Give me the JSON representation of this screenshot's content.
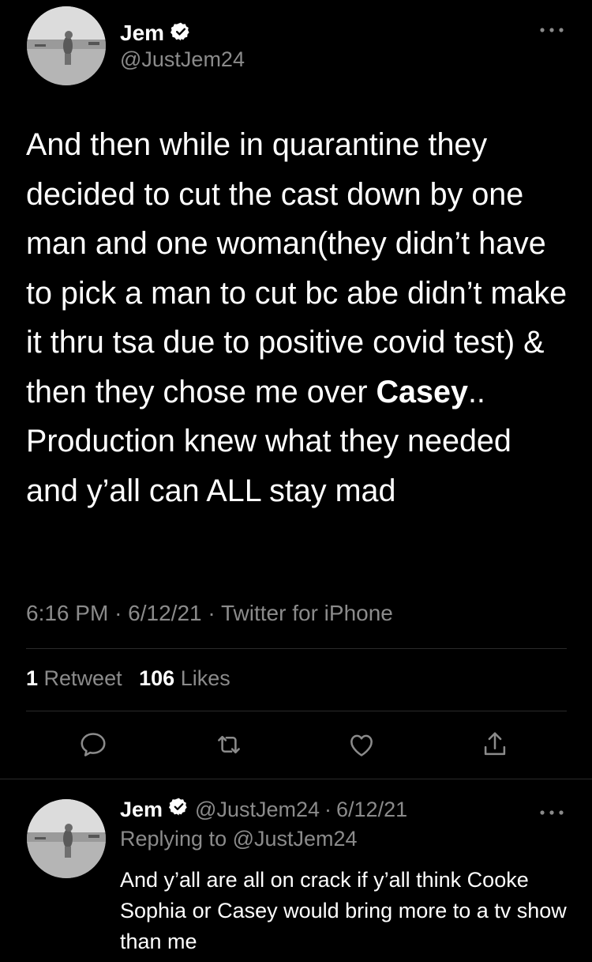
{
  "tweet": {
    "author_name": "Jem",
    "handle": "@JustJem24",
    "more_icon": "more-horizontal-icon",
    "verified_icon": "verified-badge-icon",
    "text_before_bold": "And then while in quarantine they decided to cut the cast down by one man and one woman(they didn’t have to pick a man to cut bc abe didn’t make it thru tsa due to positive covid test) & then they chose me over ",
    "text_bold": "Casey",
    "text_after_bold": ".. Production knew what they needed and y’all can ALL stay mad",
    "time": "6:16 PM",
    "date": "6/12/21",
    "source": "Twitter for iPhone",
    "separator": "·",
    "stats": {
      "retweets_count": "1",
      "retweets_label": "Retweet",
      "likes_count": "106",
      "likes_label": "Likes"
    },
    "actions": [
      "reply-icon",
      "retweet-icon",
      "like-icon",
      "share-icon"
    ]
  },
  "reply": {
    "author_name": "Jem",
    "handle": "@JustJem24",
    "separator": "·",
    "date": "6/12/21",
    "replying_to_prefix": "Replying to",
    "replying_to_handle": "@JustJem24",
    "text": "And y’all are all on crack if y’all think Cooke Sophia or Casey would bring more to a tv show than me"
  },
  "colors": {
    "background": "#000000",
    "text": "#ffffff",
    "muted": "#8b8b8b",
    "divider": "#2a2a2a"
  }
}
